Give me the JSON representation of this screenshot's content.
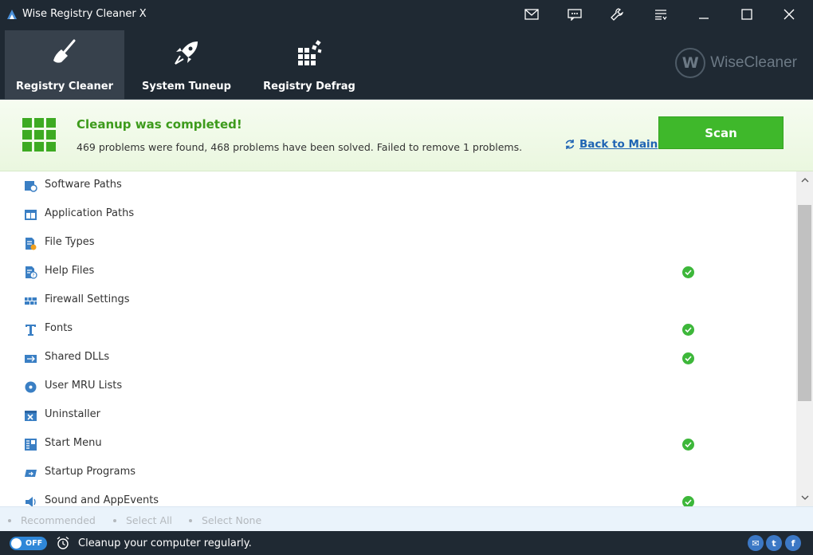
{
  "window": {
    "title": "Wise Registry Cleaner X",
    "titlebar_icons": [
      "mail-icon",
      "feedback-icon",
      "settings-wrench-icon",
      "menu-icon",
      "minimize-icon",
      "maximize-icon",
      "close-icon"
    ]
  },
  "nav": {
    "tabs": [
      {
        "label": "Registry Cleaner",
        "icon": "broom-icon",
        "active": true
      },
      {
        "label": "System Tuneup",
        "icon": "rocket-icon",
        "active": false
      },
      {
        "label": "Registry Defrag",
        "icon": "defrag-blocks-icon",
        "active": false
      }
    ],
    "brand": {
      "logo_letter": "W",
      "name": "WiseCleaner"
    }
  },
  "status": {
    "title": "Cleanup was completed!",
    "summary": "469 problems were found, 468 problems have been solved. Failed to remove 1 problems.",
    "back_link": "Back to Main",
    "scan_button": "Scan"
  },
  "list": {
    "items": [
      {
        "label": "Software Paths",
        "icon": "software-paths-icon",
        "checked": false
      },
      {
        "label": "Application Paths",
        "icon": "application-paths-icon",
        "checked": false
      },
      {
        "label": "File Types",
        "icon": "file-types-icon",
        "checked": false
      },
      {
        "label": "Help Files",
        "icon": "help-files-icon",
        "checked": true
      },
      {
        "label": "Firewall Settings",
        "icon": "firewall-icon",
        "checked": false
      },
      {
        "label": "Fonts",
        "icon": "fonts-icon",
        "checked": true
      },
      {
        "label": "Shared DLLs",
        "icon": "shared-dlls-icon",
        "checked": true
      },
      {
        "label": "User MRU Lists",
        "icon": "mru-lists-icon",
        "checked": false
      },
      {
        "label": "Uninstaller",
        "icon": "uninstaller-icon",
        "checked": false
      },
      {
        "label": "Start Menu",
        "icon": "start-menu-icon",
        "checked": true
      },
      {
        "label": "Startup Programs",
        "icon": "startup-programs-icon",
        "checked": false
      },
      {
        "label": "Sound and AppEvents",
        "icon": "sound-icon",
        "checked": true
      }
    ]
  },
  "selection": {
    "recommended": "Recommended",
    "select_all": "Select All",
    "select_none": "Select None"
  },
  "footer": {
    "toggle_label": "OFF",
    "message": "Cleanup your computer regularly.",
    "social": [
      {
        "name": "email-share-icon",
        "glyph": "✉"
      },
      {
        "name": "twitter-icon",
        "glyph": "t"
      },
      {
        "name": "facebook-icon",
        "glyph": "f"
      }
    ]
  },
  "colors": {
    "titlebar_bg": "#1f2933",
    "active_tab_bg": "#37414c",
    "status_green": "#3d9b1c",
    "scan_button": "#3fb82b",
    "link_blue": "#1f64b4",
    "icon_blue": "#3a7fc4",
    "check_green": "#3db73a"
  }
}
